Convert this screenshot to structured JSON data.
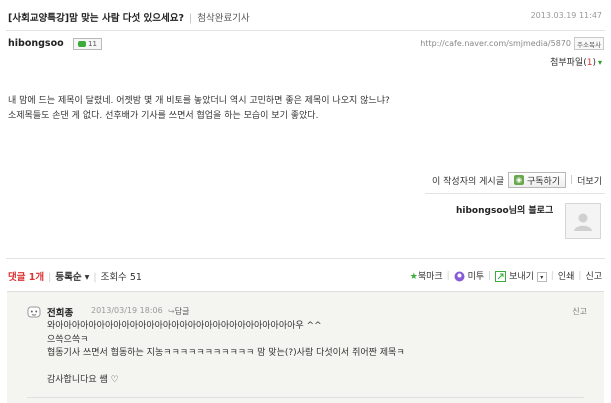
{
  "post": {
    "title": "[사회교양특강]맘 맞는 사람 다섯 있으세요?",
    "category": "첨삭완료기사",
    "date": "2013.03.19 11:47",
    "author": "hibongsoo",
    "chat_count": "11",
    "url": "http://cafe.naver.com/smjmedia/5870",
    "copy_address_label": "주소복사",
    "attachments_label": "첨부파일",
    "attachments_count": "1",
    "body_line1": "내 맘에 드는 제목이 달렸네. 어젯밤 몇 개 비토를 놓았더니 역시 고민하면 좋은 제목이 나오지 않느냐?",
    "body_line2": "소제목들도 손댄 게 없다. 선후배가 기사를 쓰면서 협업을 하는 모습이 보기 좋았다."
  },
  "author_box": {
    "posts_label": "이 작성자의 게시글",
    "subscribe_label": "구독하기",
    "more_label": "더보기",
    "blog_label": "hibongsoo님의 블로그"
  },
  "comment_bar": {
    "comments_label": "댓글 1개",
    "sort_label": "등록순",
    "views_label": "조회수 51",
    "bookmark": "북마크",
    "metoo": "미투",
    "send": "보내기",
    "print": "인쇄",
    "report": "신고"
  },
  "comment": {
    "name": "전희종",
    "date": "2013/03/19 18:06",
    "reply": "답글",
    "report": "신고",
    "line1": "와아아아아아아아아아아아아아아아아아아아아아아아아아아아아아우 ^^",
    "line2": "으쓱으쓱ㅋ",
    "line3": "협동기사 쓰면서 협동하는 지농ㅋㅋㅋㅋㅋㅋㅋㅋㅋㅋㅋ 맘 맞는(?)사람 다섯이서 쥐어짠 제목ㅋ",
    "line4": "감사합니다요 쌤 ♡"
  },
  "colors": {
    "red": "#dd3333",
    "green": "#3bab3b",
    "comment_bg": "#f4f5f0"
  }
}
